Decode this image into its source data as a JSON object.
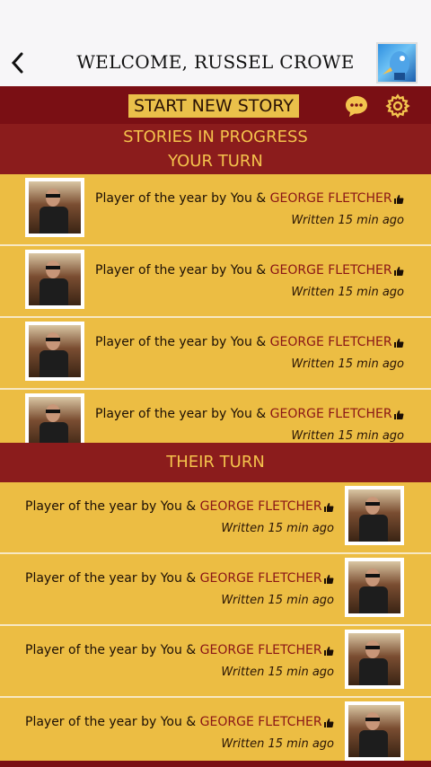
{
  "header": {
    "title": "WELCOME, RUSSEL CROWE"
  },
  "toolbar": {
    "start_label": "START NEW STORY"
  },
  "section1": {
    "line1": "STORIES IN PROGRESS",
    "line2": "YOUR TURN",
    "items": [
      {
        "title": "Player of the year by You &",
        "partner": "GEORGE FLETCHER",
        "time": "Written 15 min ago"
      },
      {
        "title": "Player of the year by You &",
        "partner": "GEORGE FLETCHER",
        "time": "Written 15 min ago"
      },
      {
        "title": "Player of the year by You &",
        "partner": "GEORGE FLETCHER",
        "time": "Written 15 min ago"
      },
      {
        "title": "Player of the year by You &",
        "partner": "GEORGE FLETCHER",
        "time": "Written 15 min ago"
      }
    ]
  },
  "section2": {
    "title": "THEIR TURN",
    "items": [
      {
        "title": "Player of the year by You &",
        "partner": "GEORGE FLETCHER",
        "time": "Written 15 min ago"
      },
      {
        "title": "Player of the year by You &",
        "partner": "GEORGE FLETCHER",
        "time": "Written 15 min ago"
      },
      {
        "title": "Player of the year by You &",
        "partner": "GEORGE FLETCHER",
        "time": "Written 15 min ago"
      },
      {
        "title": "Player of the year by You &",
        "partner": "GEORGE FLETCHER",
        "time": "Written 15 min ago"
      }
    ]
  },
  "icons": [
    "back-icon",
    "profile-avatar",
    "chat-icon",
    "gear-icon",
    "thumbs-up-icon"
  ],
  "colors": {
    "accent": "#eac04a",
    "bar": "#7a0f14",
    "partner": "#8a1616"
  }
}
